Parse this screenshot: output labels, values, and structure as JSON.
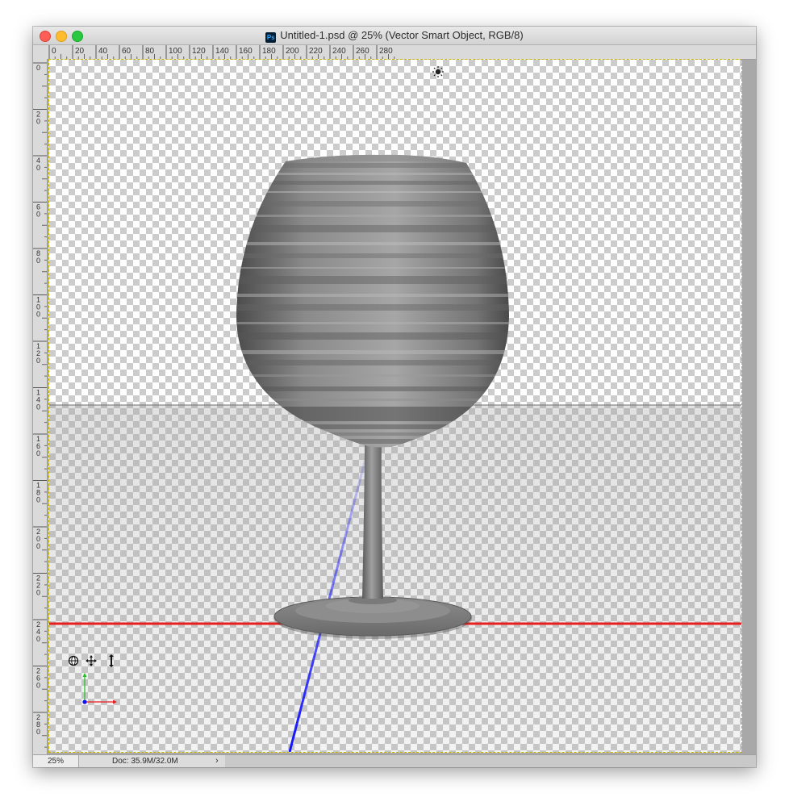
{
  "window": {
    "title": "Untitled-1.psd @ 25% (Vector Smart Object, RGB/8)",
    "app_icon": "Ps"
  },
  "rulers": {
    "horizontal": [
      "0",
      "20",
      "40",
      "60",
      "80",
      "100",
      "120",
      "140",
      "160",
      "180",
      "200",
      "220",
      "240",
      "260",
      "280"
    ],
    "vertical": [
      "0",
      "2 0",
      "4 0",
      "6 0",
      "8 0",
      "1 0 0",
      "1 2 0",
      "1 4 0",
      "1 6 0",
      "1 8 0",
      "2 0 0",
      "2 2 0",
      "2 4 0",
      "2 6 0",
      "2 8 0"
    ]
  },
  "canvas": {
    "object": "wine-glass-3d-model",
    "icons": [
      "light-source-icon",
      "3d-rotate-icon",
      "3d-pan-icon",
      "3d-slide-icon",
      "3d-axis-widget"
    ],
    "axis_colors": {
      "x": "#ff2a2a",
      "y": "#1ec31e",
      "z": "#1010ff"
    }
  },
  "status": {
    "zoom": "25%",
    "doc": "Doc: 35.9M/32.0M",
    "arrow": "›"
  }
}
